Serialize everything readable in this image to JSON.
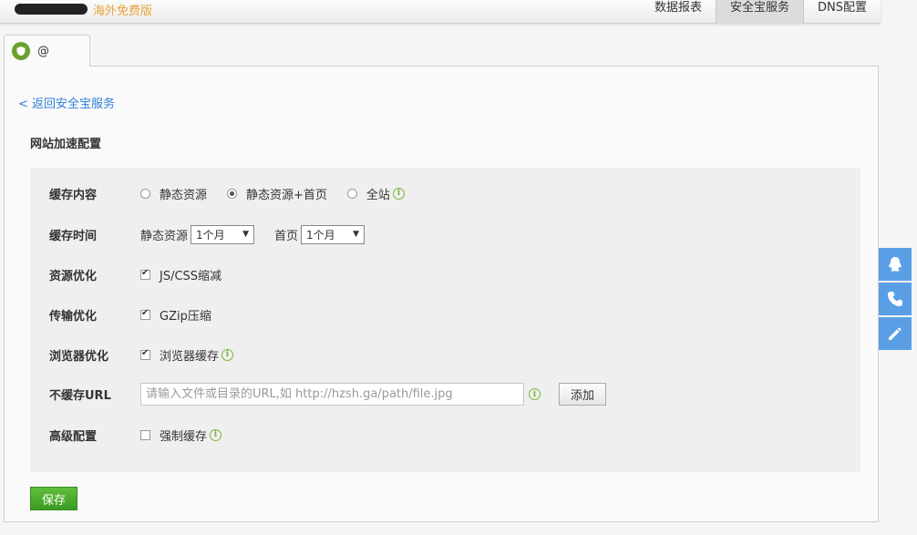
{
  "header": {
    "brand_sub": "海外免费版",
    "nav": [
      {
        "label": "数据报表"
      },
      {
        "label": "安全宝服务"
      },
      {
        "label": "DNS配置"
      }
    ]
  },
  "tab": {
    "label": "@"
  },
  "back_link": "< 返回安全宝服务",
  "section_title": "网站加速配置",
  "form": {
    "cache_content": {
      "label": "缓存内容",
      "options": [
        "静态资源",
        "静态资源+首页",
        "全站"
      ],
      "selected": "静态资源+首页"
    },
    "cache_time": {
      "label": "缓存时间",
      "static_label": "静态资源",
      "static_value": "1个月",
      "home_label": "首页",
      "home_value": "1个月"
    },
    "resource_opt": {
      "label": "资源优化",
      "option": "JS/CSS缩减",
      "checked": true
    },
    "transfer_opt": {
      "label": "传输优化",
      "option": "GZip压缩",
      "checked": true
    },
    "browser_opt": {
      "label": "浏览器优化",
      "option": "浏览器缓存",
      "checked": true
    },
    "nocache_url": {
      "label": "不缓存URL",
      "placeholder": "请输入文件或目录的URL,如 http://hzsh.ga/path/file.jpg",
      "add_label": "添加"
    },
    "advanced": {
      "label": "高级配置",
      "option": "强制缓存",
      "checked": false
    }
  },
  "save_label": "保存",
  "colors": {
    "accent": "#5a9fe6",
    "brand_sub": "#e8a33b",
    "save": "#4caf30",
    "info": "#7db33a",
    "link": "#2f7fd5"
  },
  "side_tools": [
    "qq-icon",
    "phone-icon",
    "pencil-icon"
  ]
}
